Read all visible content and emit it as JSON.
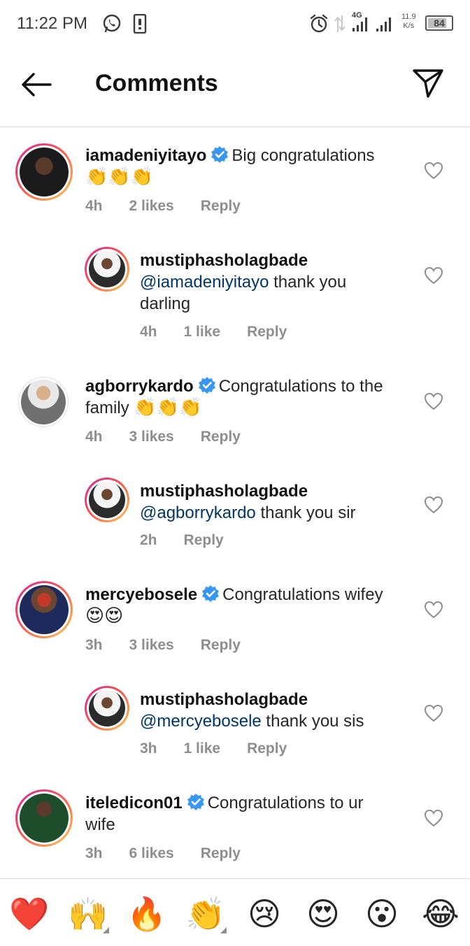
{
  "status_bar": {
    "time": "11:22 PM",
    "network_type": "4G",
    "speed_value": "11.9",
    "speed_unit": "K/s",
    "battery": "84"
  },
  "header": {
    "title": "Comments"
  },
  "comments": [
    {
      "username": "iamadeniyitayo",
      "verified": true,
      "text": "Big congratulations",
      "emoji": "👏👏👏",
      "time": "4h",
      "likes": "2 likes",
      "reply": "Reply"
    },
    {
      "username": "mustiphasholagbade",
      "mention": "@iamadeniyitayo",
      "text": " thank you darling",
      "time": "4h",
      "likes": "1 like",
      "reply": "Reply"
    },
    {
      "username": "agborrykardo",
      "verified": true,
      "text": "Congratulations to the family",
      "emoji": "👏👏👏",
      "time": "4h",
      "likes": "3 likes",
      "reply": "Reply"
    },
    {
      "username": "mustiphasholagbade",
      "mention": "@agborrykardo",
      "text": " thank you sir",
      "time": "2h",
      "reply": "Reply"
    },
    {
      "username": "mercyebosele",
      "verified": true,
      "text": "Congratulations wifey",
      "emoji": "😍😍",
      "time": "3h",
      "likes": "3 likes",
      "reply": "Reply"
    },
    {
      "username": "mustiphasholagbade",
      "mention": "@mercyebosele",
      "text": " thank you sis",
      "time": "3h",
      "likes": "1 like",
      "reply": "Reply"
    },
    {
      "username": "iteledicon01",
      "verified": true,
      "text": "Congratulations to ur wife",
      "time": "3h",
      "likes": "6 likes",
      "reply": "Reply"
    }
  ],
  "reactions": [
    "❤️",
    "🙌",
    "🔥",
    "👏",
    "😢",
    "😍",
    "😮",
    "😂"
  ],
  "colors": {
    "verified_blue": "#3897f0",
    "mention_blue": "#003569",
    "muted_gray": "#8e8e8e",
    "story_ring": "#fd5949"
  }
}
